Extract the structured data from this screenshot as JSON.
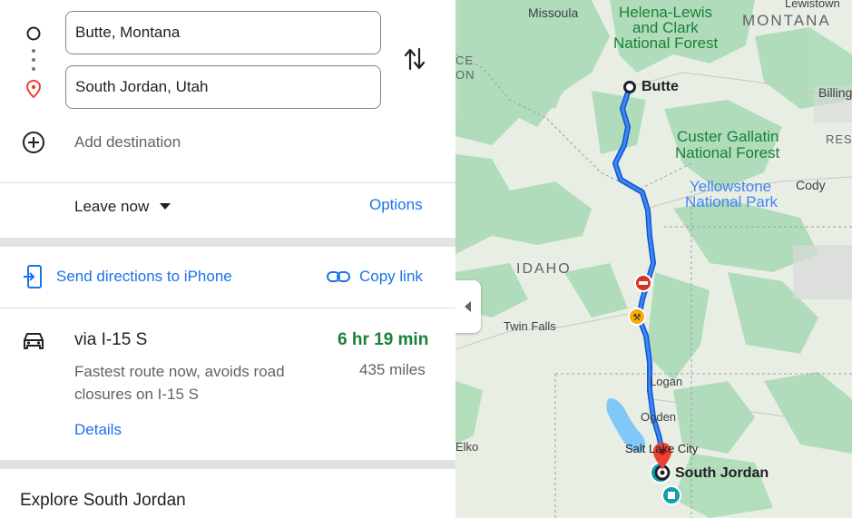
{
  "directions": {
    "origin": "Butte, Montana",
    "destination": "South Jordan, Utah",
    "add_destination": "Add destination",
    "leave_now": "Leave now",
    "options": "Options",
    "send_to_phone": "Send directions to iPhone",
    "copy_link": "Copy link"
  },
  "route": {
    "via": "via I-15 S",
    "duration": "6 hr 19 min",
    "description": "Fastest route now, avoids road closures on I-15 S",
    "distance": "435 miles",
    "details": "Details"
  },
  "explore": "Explore South Jordan",
  "map": {
    "labels": {
      "missoula": "Missoula",
      "helena_lewis": "Helena-Lewis",
      "and_clark": "and Clark",
      "national_forest": "National Forest",
      "montana": "MONTANA",
      "lewistown": "Lewistown",
      "butte": "Butte",
      "billings": "Billing",
      "custer_gallatin": "Custer Gallatin",
      "custer_nf": "National Forest",
      "res": "RES",
      "yellowstone": "Yellowstone",
      "yellowstone_np": "National Park",
      "cody": "Cody",
      "idaho": "IDAHO",
      "twin_falls": "Twin Falls",
      "logan": "Logan",
      "ogden": "Ogden",
      "elko": "Elko",
      "salt_lake_city": "Salt Lake City",
      "south_jordan": "South Jordan",
      "ce": "CE",
      "on": "ON"
    }
  }
}
